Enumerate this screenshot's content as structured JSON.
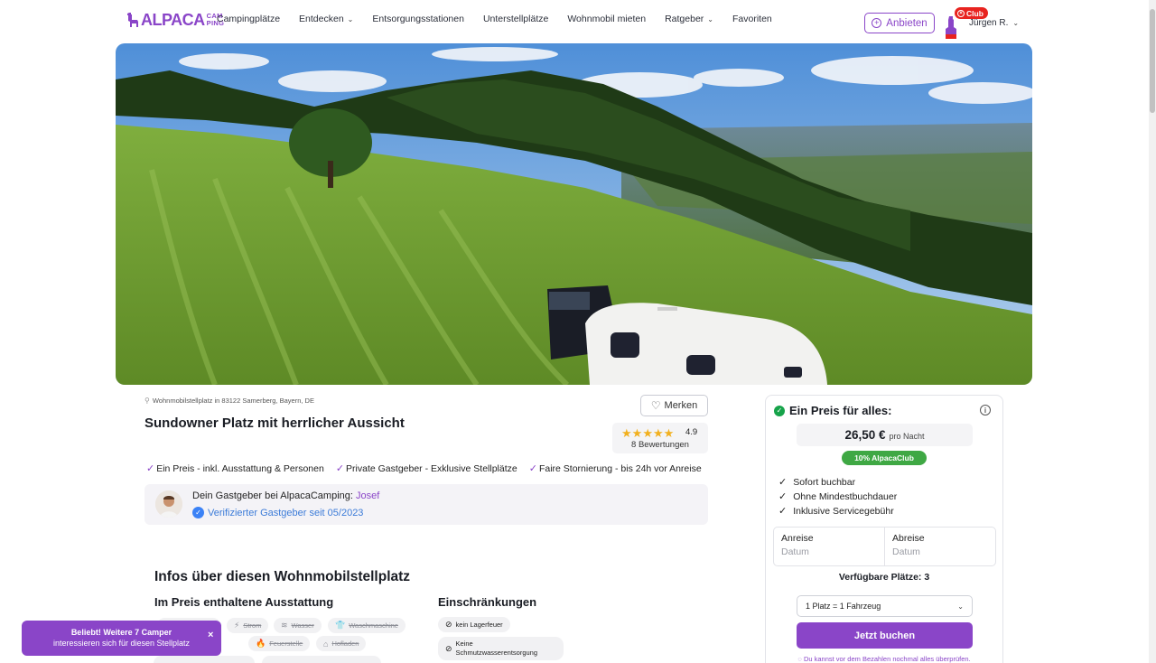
{
  "header": {
    "logo_alpaca": "ALPACA",
    "logo_camping_top": "CAM",
    "logo_camping_bottom": "PING",
    "nav": [
      {
        "label": "Campingplätze",
        "dropdown": false
      },
      {
        "label": "Entdecken",
        "dropdown": true
      },
      {
        "label": "Entsorgungsstationen",
        "dropdown": false
      },
      {
        "label": "Unterstellplätze",
        "dropdown": false
      },
      {
        "label": "Wohnmobil mieten",
        "dropdown": false
      },
      {
        "label": "Ratgeber",
        "dropdown": true
      },
      {
        "label": "Favoriten",
        "dropdown": false
      }
    ],
    "offer_button": "Anbieten",
    "club_badge": "Club",
    "user_name": "Jürgen R."
  },
  "listing": {
    "location": "Wohnmobilstellplatz in 83122 Samerberg, Bayern, DE",
    "title": "Sundowner Platz mit herrlicher Aussicht",
    "save_button": "Merken",
    "rating_value": "4.9",
    "rating_stars": 5,
    "rating_count": "8 Bewertungen",
    "features": [
      "Ein Preis - inkl. Ausstattung & Personen",
      "Private Gastgeber - Exklusive Stellplätze",
      "Faire Stornierung - bis 24h vor Anreise"
    ],
    "host_intro": "Dein Gastgeber bei AlpacaCamping: ",
    "host_name": "Josef",
    "host_verified": "Verifizierter Gastgeber seit 05/2023"
  },
  "infos": {
    "section_title": "Infos über diesen Wohnmobilstellplatz",
    "included_title": "Im Preis enthaltene Ausstattung",
    "included": [
      "Strom",
      "Wasser",
      "Waschmaschine",
      "Feuerstelle",
      "Hofladen"
    ],
    "restrictions_title": "Einschränkungen",
    "restrictions": [
      "kein Lagerfeuer",
      "Keine Schmutzwasserentsorgung"
    ]
  },
  "booking": {
    "head": "Ein Preis für alles:",
    "price": "26,50 €",
    "price_unit": "pro Nacht",
    "club_discount": "10% AlpacaClub",
    "perks": [
      "Sofort buchbar",
      "Ohne Mindestbuchdauer",
      "Inklusive Servicegebühr"
    ],
    "arrival_label": "Anreise",
    "arrival_placeholder": "Datum",
    "departure_label": "Abreise",
    "departure_placeholder": "Datum",
    "available": "Verfügbare Plätze: 3",
    "select_value": "1 Platz = 1 Fahrzeug",
    "book_button": "Jetzt buchen",
    "note": "Du kannst vor dem Bezahlen nochmal alles überprüfen."
  },
  "toast": {
    "line1": "Beliebt! Weitere 7 Camper",
    "line2": "interessieren sich für diesen Stellplatz"
  },
  "colors": {
    "brand": "#8a45c8",
    "club_red": "#e8231f",
    "discount_green": "#3fa844",
    "verified_blue": "#3b82f6",
    "star": "#f2b01e"
  }
}
